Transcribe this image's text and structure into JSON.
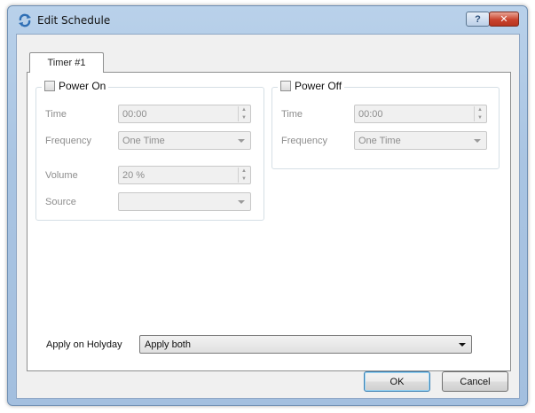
{
  "window": {
    "title": "Edit Schedule",
    "help_label": "?",
    "close_label": "✕"
  },
  "tab": {
    "label": "Timer #1"
  },
  "power_on": {
    "label": "Power On",
    "checked": false,
    "time_label": "Time",
    "time_value": "00:00",
    "frequency_label": "Frequency",
    "frequency_value": "One Time",
    "volume_label": "Volume",
    "volume_value": "20 %",
    "source_label": "Source",
    "source_value": ""
  },
  "power_off": {
    "label": "Power Off",
    "checked": false,
    "time_label": "Time",
    "time_value": "00:00",
    "frequency_label": "Frequency",
    "frequency_value": "One Time"
  },
  "holyday": {
    "label": "Apply on Holyday",
    "value": "Apply both"
  },
  "buttons": {
    "ok": "OK",
    "cancel": "Cancel"
  },
  "spin": {
    "up": "▲",
    "down": "▼"
  },
  "icons": {
    "app": "schedule-icon",
    "dropdown": "chevron-down-icon"
  }
}
